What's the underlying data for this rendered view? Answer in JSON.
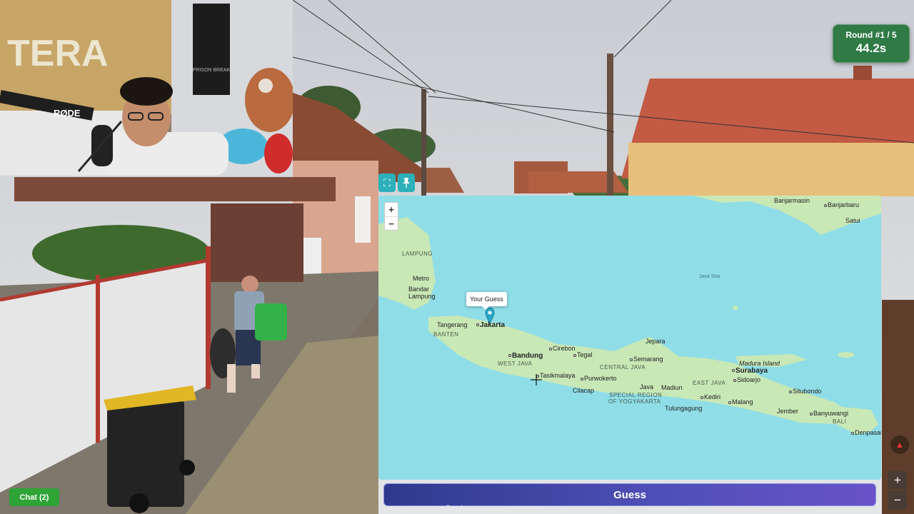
{
  "round": {
    "label": "Round #1 / 5",
    "timer": "44.2s"
  },
  "map": {
    "zoom_in": "+",
    "zoom_out": "−",
    "guess_tooltip": "Your Guess",
    "labels": {
      "banjarmasin": "Banjarmasin",
      "banjarbaru": "Banjarbaru",
      "satui": "Satui",
      "lampung": "LAMPUNG",
      "metro": "Metro",
      "bandar_lampung": "Bandar\nLampung",
      "java_sea": "Java Sea",
      "tangerang": "Tangerang",
      "jakarta": "Jakarta",
      "banten": "BANTEN",
      "bandung": "Bandung",
      "cirebon": "Cirebon",
      "tegal": "Tegal",
      "jepara": "Jepara",
      "semarang": "Semarang",
      "west_java": "WEST JAVA",
      "central_java": "CENTRAL JAVA",
      "tasikmalaya": "Tasikmalaya",
      "purwokerto": "Purwokerto",
      "cilacap": "Cilacap",
      "java": "Java",
      "special_region": "SPECIAL REGION",
      "of_yogyakarta": "OF YOGYAKARTA",
      "madiun": "Madiun",
      "madura_island": "Madura Island",
      "surabaya": "Surabaya",
      "sidoarjo": "Sidoarjo",
      "east_java": "EAST JAVA",
      "kediri": "Kediri",
      "malang": "Malang",
      "tulungagung": "Tulungagung",
      "situbondo": "Situbondo",
      "jember": "Jember",
      "banyuwangi": "Banyuwangi",
      "bali": "BALI",
      "denpasar": "Denpasar"
    }
  },
  "guess_button": "Guess",
  "chat_button": "Chat (2)",
  "google_attribution": "Google",
  "webcam_banner": "TERA",
  "mic_brand": "RØDE",
  "poster_text": "PRISON BREAK",
  "colors": {
    "round_bg": "#2f7a45",
    "map_sea": "#8fdde7",
    "map_land": "#c8e8b6",
    "guess_start": "#2e3a8c",
    "guess_end": "#6952c9",
    "chat_bg": "#2ea336"
  }
}
